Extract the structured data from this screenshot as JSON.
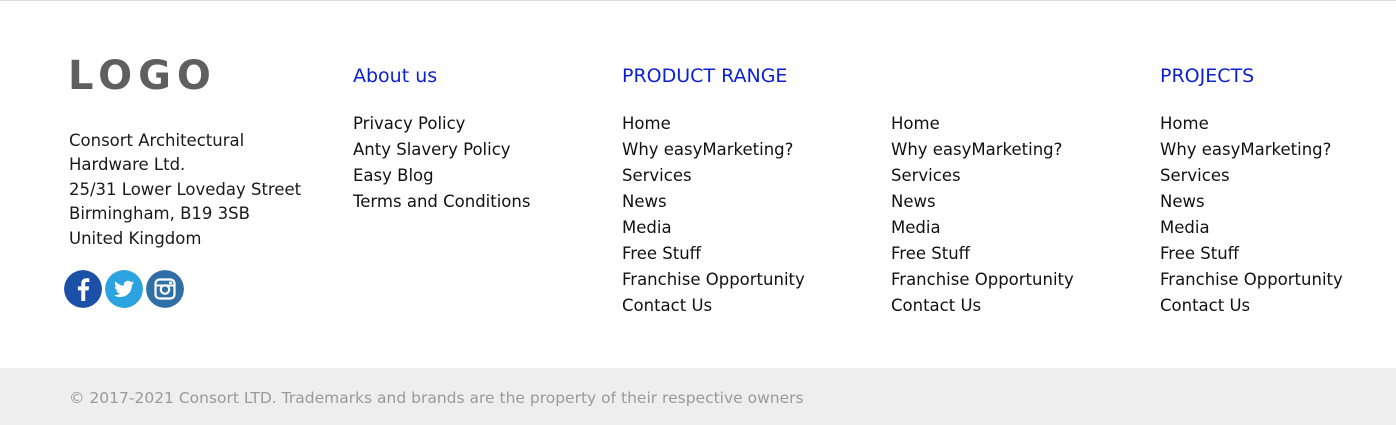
{
  "brand": {
    "logo_text": "LOGO"
  },
  "address": {
    "lines": [
      "Consort Architectural",
      "Hardware Ltd.",
      "25/31 Lower Loveday Street",
      "Birmingham, B19 3SB",
      "United Kingdom"
    ]
  },
  "social": {
    "icons": [
      "facebook-icon",
      "twitter-icon",
      "instagram-icon"
    ],
    "colors": {
      "facebook": "#1c4fa8",
      "twitter": "#2aa3e0",
      "instagram": "#2f6fa8"
    }
  },
  "about": {
    "heading": "About us",
    "links": [
      "Privacy Policy",
      "Anty Slavery Policy",
      "Easy Blog",
      "Terms and Conditions"
    ]
  },
  "product_range": {
    "heading": "PRODUCT RANGE",
    "links": [
      "Home",
      "Why easyMarketing?",
      "Services",
      "News",
      "Media",
      "Free Stuff",
      "Franchise Opportunity",
      "Contact Us"
    ]
  },
  "extra": {
    "links": [
      "Home",
      "Why easyMarketing?",
      "Services",
      "News",
      "Media",
      "Free Stuff",
      "Franchise Opportunity",
      "Contact Us"
    ]
  },
  "projects": {
    "heading": "PROJECTS",
    "links": [
      "Home",
      "Why easyMarketing?",
      "Services",
      "News",
      "Media",
      "Free Stuff",
      "Franchise Opportunity",
      "Contact Us"
    ]
  },
  "footer": {
    "copyright": "© 2017-2021 Consort LTD. Trademarks and brands are the property of their respective owners"
  },
  "theme": {
    "heading_color": "#0a1fd6",
    "footer_bg": "#eeeeee"
  }
}
